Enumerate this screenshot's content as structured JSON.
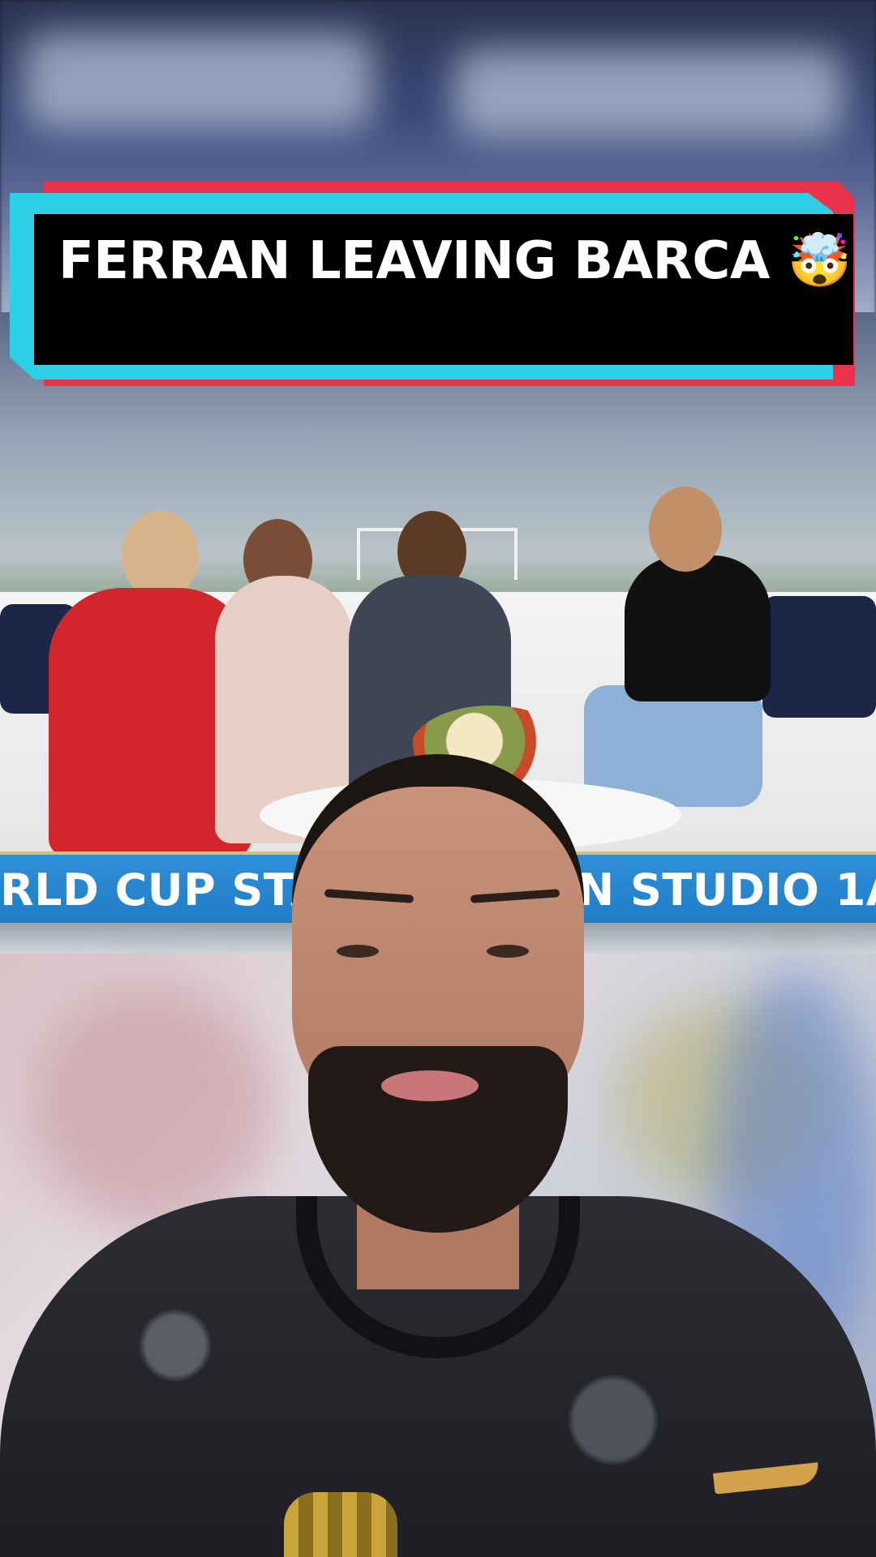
{
  "caption": {
    "text": "FERRAN LEAVING BARCA",
    "emoji": "🤯"
  },
  "broadcast": {
    "chyron_left": "RLD CUP STAR FE",
    "chyron_right": "N STUDIO 1A"
  },
  "colors": {
    "caption_red": "#e8334a",
    "caption_cyan": "#2dd0e6",
    "caption_bg": "#000000",
    "chyron_blue": "#1f7cc4"
  }
}
